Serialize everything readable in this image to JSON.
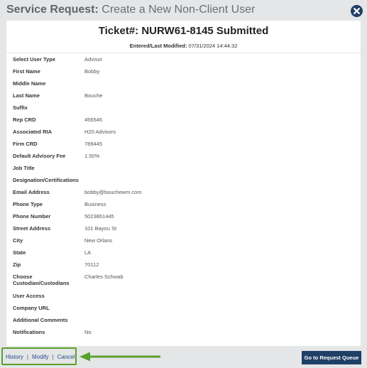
{
  "header": {
    "title_bold": "Service Request:",
    "title_rest": " Create a New Non-Client User"
  },
  "ticket": {
    "title": "Ticket#: NURW61-8145 Submitted",
    "entered_label": "Entered/Last Modified:",
    "entered_value": "07/31/2024 14:44:32"
  },
  "fields": [
    {
      "label": "Select User Type",
      "value": "Advisor"
    },
    {
      "label": "First Name",
      "value": "Bobby"
    },
    {
      "label": "Middle Name",
      "value": ""
    },
    {
      "label": "Last Name",
      "value": "Bouche"
    },
    {
      "label": "Suffix",
      "value": ""
    },
    {
      "label": "Rep CRD",
      "value": "456546"
    },
    {
      "label": "Associated RIA",
      "value": "H20 Advisors"
    },
    {
      "label": "Firm CRD",
      "value": "789445"
    },
    {
      "label": "Default Advisory Fee",
      "value": "1.50%"
    },
    {
      "label": "Job Title",
      "value": ""
    },
    {
      "label": "Designation/Certifications",
      "value": ""
    },
    {
      "label": "Email Address",
      "value": "bobby@bouchewm.com"
    },
    {
      "label": "Phone Type",
      "value": "Business"
    },
    {
      "label": "Phone Number",
      "value": "5023861445"
    },
    {
      "label": "Street Address",
      "value": "101 Bayou St"
    },
    {
      "label": "City",
      "value": "New Orlans"
    },
    {
      "label": "State",
      "value": "LA"
    },
    {
      "label": "Zip",
      "value": "70112"
    },
    {
      "label": "Choose Custodian/Custodians",
      "value": "Charles Schwab"
    },
    {
      "label": "User Access",
      "value": ""
    },
    {
      "label": "Company URL",
      "value": ""
    },
    {
      "label": "Additional Comments",
      "value": ""
    },
    {
      "label": "Notifications",
      "value": "No"
    }
  ],
  "footer": {
    "history": "History",
    "modify": "Modify",
    "cancel": "Cancel",
    "separator": "|",
    "queue_button": "Go to Request Queue"
  },
  "colors": {
    "accent": "#1f3f66",
    "highlight": "#5aa02c"
  }
}
